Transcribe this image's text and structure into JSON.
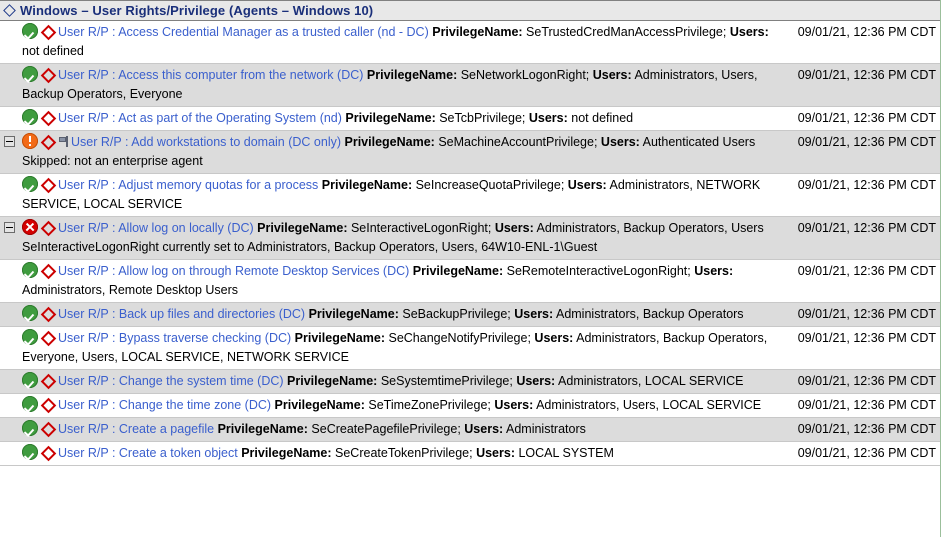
{
  "header": {
    "icon": "blue-diamond-icon",
    "title": "Windows – User Rights/Privilege (Agents – Windows 10)"
  },
  "labels": {
    "privilege_name": "PrivilegeName:",
    "users": "Users:"
  },
  "timestamp": "09/01/21, 12:36 PM CDT",
  "colors": {
    "link": "#3a5fcd",
    "header_text": "#1a2f7a",
    "header_bg": "#e8e8e8",
    "stripe_bg": "#dcdcdc",
    "ok": "#3f9c3f",
    "error": "#d40000",
    "warning": "#f26a17",
    "diamond": "#cc0000"
  },
  "rows": [
    {
      "status": "ok",
      "expander": false,
      "flag": false,
      "stripe": false,
      "link": "User R/P : Access Credential Manager as a trusted caller (nd - DC)",
      "privilege": "SeTrustedCredManAccessPrivilege;",
      "users": "not defined",
      "timestamp": "09/01/21, 12:36 PM CDT",
      "note": ""
    },
    {
      "status": "ok",
      "expander": false,
      "flag": false,
      "stripe": true,
      "link": "User R/P : Access this computer from the network (DC)",
      "privilege": "SeNetworkLogonRight;",
      "users": "Administrators, Users, Backup Operators, Everyone",
      "timestamp": "09/01/21, 12:36 PM CDT",
      "note": ""
    },
    {
      "status": "ok",
      "expander": false,
      "flag": false,
      "stripe": false,
      "link": "User R/P : Act as part of the Operating System (nd)",
      "privilege": "SeTcbPrivilege;",
      "users": "not defined",
      "timestamp": "09/01/21, 12:36 PM CDT",
      "note": ""
    },
    {
      "status": "warning",
      "expander": true,
      "flag": true,
      "stripe": true,
      "link": "User R/P : Add workstations to domain (DC only)",
      "privilege": "SeMachineAccountPrivilege;",
      "users": "Authenticated Users",
      "timestamp": "09/01/21, 12:36 PM CDT",
      "note": "Skipped: not an enterprise agent"
    },
    {
      "status": "ok",
      "expander": false,
      "flag": false,
      "stripe": false,
      "link": "User R/P : Adjust memory quotas for a process",
      "privilege": "SeIncreaseQuotaPrivilege;",
      "users": "Administrators, NETWORK SERVICE, LOCAL SERVICE",
      "timestamp": "09/01/21, 12:36 PM CDT",
      "note": ""
    },
    {
      "status": "error",
      "expander": true,
      "flag": false,
      "stripe": true,
      "link": "User R/P : Allow log on locally (DC)",
      "privilege": "SeInteractiveLogonRight;",
      "users": "Administrators, Backup Operators, Users",
      "timestamp": "09/01/21, 12:36 PM CDT",
      "note": "SeInteractiveLogonRight currently set to Administrators, Backup Operators, Users, 64W10-ENL-1\\Guest"
    },
    {
      "status": "ok",
      "expander": false,
      "flag": false,
      "stripe": false,
      "link": "User R/P : Allow log on through Remote Desktop Services (DC)",
      "privilege": "SeRemoteInteractiveLogonRight;",
      "users": "Administrators, Remote Desktop Users",
      "timestamp": "09/01/21, 12:36 PM CDT",
      "note": ""
    },
    {
      "status": "ok",
      "expander": false,
      "flag": false,
      "stripe": true,
      "link": "User R/P : Back up files and directories (DC)",
      "privilege": "SeBackupPrivilege;",
      "users": "Administrators, Backup Operators",
      "timestamp": "09/01/21, 12:36 PM CDT",
      "note": ""
    },
    {
      "status": "ok",
      "expander": false,
      "flag": false,
      "stripe": false,
      "link": "User R/P : Bypass traverse checking (DC)",
      "privilege": "SeChangeNotifyPrivilege;",
      "users": "Administrators, Backup Operators, Everyone, Users, LOCAL SERVICE, NETWORK SERVICE",
      "timestamp": "09/01/21, 12:36 PM CDT",
      "note": ""
    },
    {
      "status": "ok",
      "expander": false,
      "flag": false,
      "stripe": true,
      "link": "User R/P : Change the system time (DC)",
      "privilege": "SeSystemtimePrivilege;",
      "users": "Administrators, LOCAL SERVICE",
      "timestamp": "09/01/21, 12:36 PM CDT",
      "note": ""
    },
    {
      "status": "ok",
      "expander": false,
      "flag": false,
      "stripe": false,
      "link": "User R/P : Change the time zone (DC)",
      "privilege": "SeTimeZonePrivilege;",
      "users": "Administrators, Users, LOCAL SERVICE",
      "timestamp": "09/01/21, 12:36 PM CDT",
      "note": ""
    },
    {
      "status": "ok",
      "expander": false,
      "flag": false,
      "stripe": true,
      "link": "User R/P : Create a pagefile",
      "privilege": "SeCreatePagefilePrivilege;",
      "users": "Administrators",
      "timestamp": "09/01/21, 12:36 PM CDT",
      "note": ""
    },
    {
      "status": "ok",
      "expander": false,
      "flag": false,
      "stripe": false,
      "link": "User R/P : Create a token object",
      "privilege": "SeCreateTokenPrivilege;",
      "users": "LOCAL SYSTEM",
      "timestamp": "09/01/21, 12:36 PM CDT",
      "note": ""
    }
  ]
}
